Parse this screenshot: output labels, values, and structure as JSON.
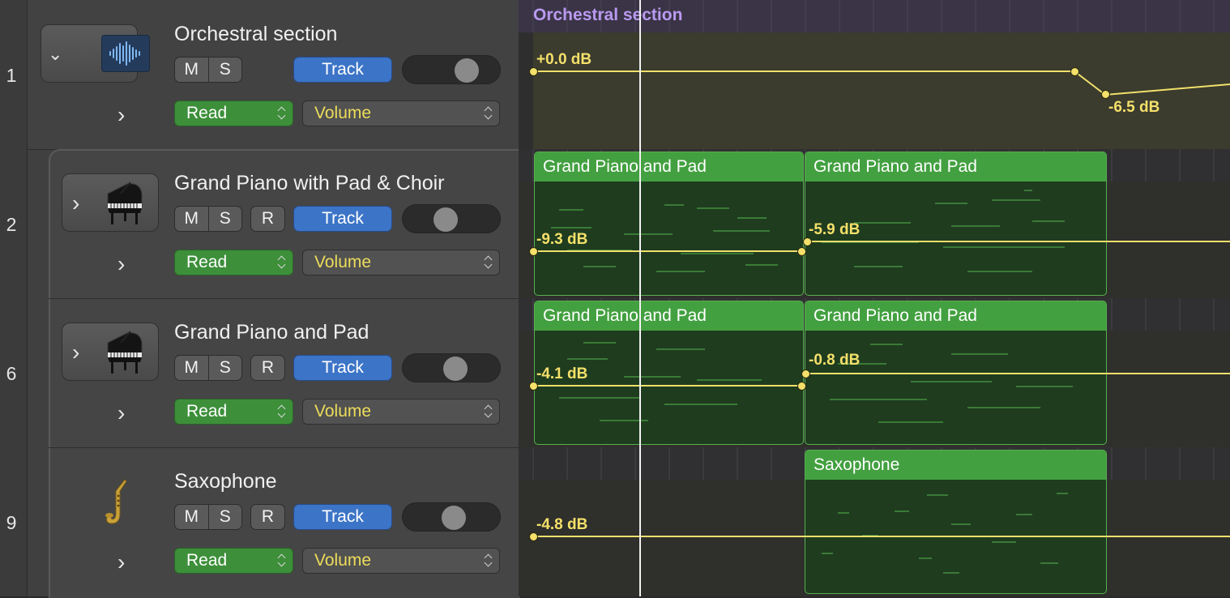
{
  "folder": {
    "label": "Orchestral section",
    "name_label_color": "#b99af0"
  },
  "tracks": [
    {
      "number": "1",
      "name": "Orchestral section",
      "icon": "waveform-icon",
      "mute": "M",
      "solo": "S",
      "record": "",
      "track_button": "Track",
      "automation_mode": "Read",
      "automation_param": "Volume",
      "volume_label": "+0.0 dB",
      "volume_label_2": "-6.5 dB"
    },
    {
      "number": "2",
      "name": "Grand Piano with Pad & Choir",
      "icon": "grand-piano-icon",
      "mute": "M",
      "solo": "S",
      "record": "R",
      "track_button": "Track",
      "automation_mode": "Read",
      "automation_param": "Volume",
      "regions": [
        "Grand Piano and Pad",
        "Grand Piano and Pad"
      ],
      "volume_label": "-9.3 dB",
      "volume_label_2": "-5.9 dB"
    },
    {
      "number": "6",
      "name": "Grand Piano and Pad",
      "icon": "grand-piano-icon",
      "mute": "M",
      "solo": "S",
      "record": "R",
      "track_button": "Track",
      "automation_mode": "Read",
      "automation_param": "Volume",
      "regions": [
        "Grand Piano and Pad",
        "Grand Piano and Pad"
      ],
      "volume_label": "-4.1 dB",
      "volume_label_2": "-0.8 dB"
    },
    {
      "number": "9",
      "name": "Saxophone",
      "icon": "saxophone-icon",
      "mute": "M",
      "solo": "S",
      "record": "R",
      "track_button": "Track",
      "automation_mode": "Read",
      "automation_param": "Volume",
      "regions": [
        "Saxophone"
      ],
      "volume_label": "-4.8 dB"
    }
  ],
  "colors": {
    "track_button": "#3c74c7",
    "read_mode": "#3d8f3a",
    "automation_line": "#f1e06a",
    "region_header": "#43a040",
    "folder_label": "#b99af0"
  }
}
